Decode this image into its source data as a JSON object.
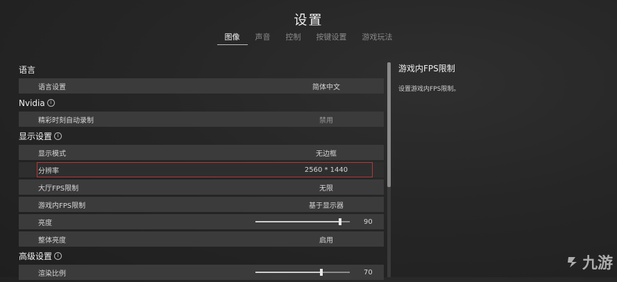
{
  "title": "设置",
  "tabs": [
    "图像",
    "声音",
    "控制",
    "按键设置",
    "游戏玩法"
  ],
  "active_tab": 0,
  "sections": {
    "language": {
      "title": "语言",
      "rows": [
        {
          "label": "语言设置",
          "value": "简体中文"
        }
      ]
    },
    "nvidia": {
      "title": "Nvidia",
      "rows": [
        {
          "label": "精彩时刻自动录制",
          "value": "禁用"
        }
      ]
    },
    "display": {
      "title": "显示设置",
      "rows": [
        {
          "label": "显示模式",
          "value": "无边框"
        },
        {
          "label": "分辨率",
          "value": "2560 * 1440"
        },
        {
          "label": "大厅FPS限制",
          "value": "无限"
        },
        {
          "label": "游戏内FPS限制",
          "value": "基于显示器"
        },
        {
          "label": "亮度",
          "value": "90",
          "slider": {
            "level": 90,
            "max": 100
          }
        },
        {
          "label": "整体亮度",
          "value": "启用"
        }
      ]
    },
    "advanced": {
      "title": "高级设置",
      "rows": [
        {
          "label": "渲染比例",
          "value": "70",
          "slider": {
            "level": 70,
            "max": 100
          }
        }
      ]
    }
  },
  "description": {
    "title": "游戏内FPS限制",
    "text": "设置游戏内FPS限制。"
  },
  "watermark": "九游"
}
